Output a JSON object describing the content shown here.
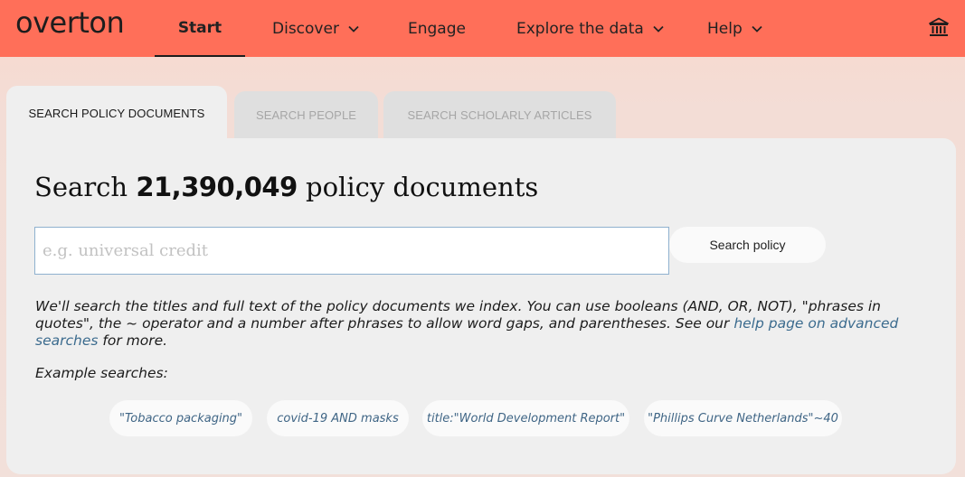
{
  "header": {
    "logo": "overton",
    "nav": [
      {
        "label": "Start",
        "active": true,
        "dropdown": false
      },
      {
        "label": "Discover",
        "active": false,
        "dropdown": true
      },
      {
        "label": "Engage",
        "active": false,
        "dropdown": false
      },
      {
        "label": "Explore the data",
        "active": false,
        "dropdown": true
      },
      {
        "label": "Help",
        "active": false,
        "dropdown": true
      }
    ],
    "right_icon": "institution-icon",
    "bar_color": "#ff6f59"
  },
  "tabs": [
    {
      "label": "SEARCH POLICY DOCUMENTS",
      "active": true
    },
    {
      "label": "SEARCH PEOPLE",
      "active": false
    },
    {
      "label": "SEARCH SCHOLARLY ARTICLES",
      "active": false
    }
  ],
  "search": {
    "headline_prefix": "Search",
    "count": "21,390,049",
    "headline_suffix": "policy documents",
    "placeholder": "e.g. universal credit",
    "value": "",
    "button_label": "Search policy"
  },
  "description": {
    "text": "We'll search the titles and full text of the policy documents we index. You can use booleans (AND, OR, NOT), \"phrases in quotes\", the ~ operator and a number after phrases to allow word gaps, and parentheses. See our ",
    "link_text": "help page on advanced searches",
    "suffix": " for more."
  },
  "examples": {
    "label": "Example searches:",
    "items": [
      "\"Tobacco packaging\"",
      "covid-19 AND masks",
      "title:\"World Development Report\"",
      "\"Phillips Curve Netherlands\"~40"
    ]
  }
}
